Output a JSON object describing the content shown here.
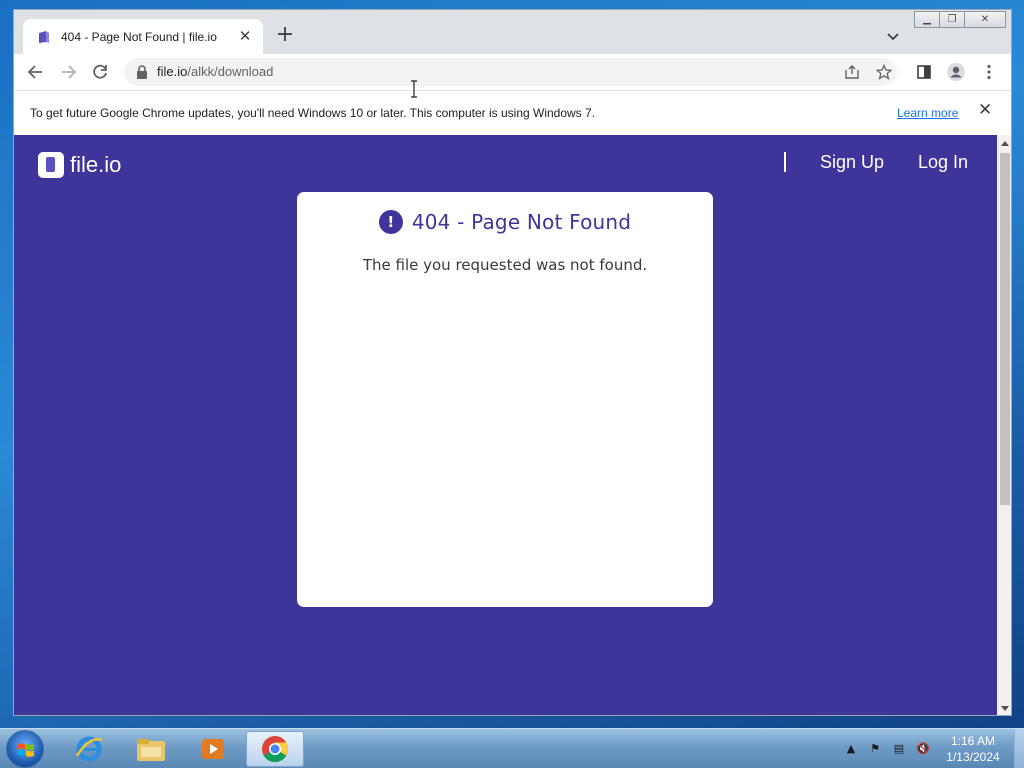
{
  "browser": {
    "tab_title": "404 - Page Not Found | file.io",
    "url_host": "file.io",
    "url_path": "/alkk/download"
  },
  "infobar": {
    "message": "To get future Google Chrome updates, you'll need Windows 10 or later. This computer is using Windows 7.",
    "learn_more": "Learn more"
  },
  "site": {
    "logo_text": "file.io",
    "nav": {
      "sign_up": "Sign Up",
      "log_in": "Log In"
    }
  },
  "error": {
    "icon": "!",
    "title": "404 - Page Not Found",
    "message": "The file you requested was not found."
  },
  "taskbar": {
    "apps": [
      "windows-start",
      "internet-explorer",
      "file-explorer",
      "media-player",
      "google-chrome"
    ],
    "active_app": "google-chrome",
    "clock_time": "1:16 AM",
    "clock_date": "1/13/2024"
  },
  "colors": {
    "page_bg": "#3d3599",
    "card_bg": "#ffffff",
    "accent": "#3d3599",
    "link": "#1a73e8"
  }
}
